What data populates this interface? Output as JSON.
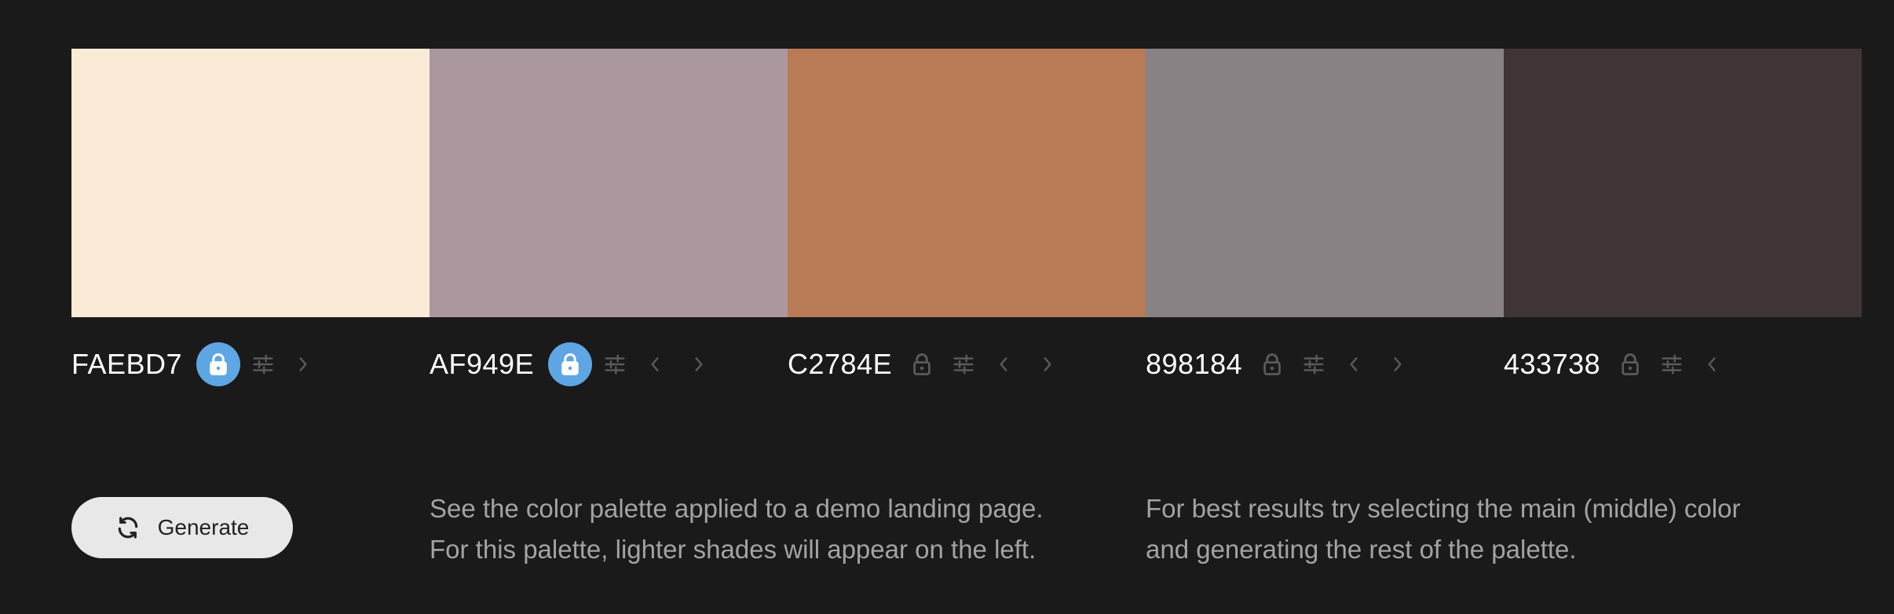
{
  "palette": {
    "colors": [
      {
        "hex": "FAEBD7",
        "value": "#FAEBD7",
        "locked": true,
        "prev": false,
        "next": true
      },
      {
        "hex": "AF949E",
        "value": "#AB979E",
        "locked": true,
        "prev": true,
        "next": true
      },
      {
        "hex": "C2784E",
        "value": "#B87B55",
        "locked": false,
        "prev": true,
        "next": true
      },
      {
        "hex": "898184",
        "value": "#888284",
        "locked": false,
        "prev": true,
        "next": true
      },
      {
        "hex": "433738",
        "value": "#403536",
        "locked": false,
        "prev": true,
        "next": false
      }
    ]
  },
  "icons": {
    "lock": "lock-icon",
    "adjust": "sliders-icon",
    "prev": "chevron-left-icon",
    "next": "chevron-right-icon",
    "refresh": "refresh-icon"
  },
  "colors": {
    "background": "#1a1a1a",
    "lock_active": "#5ea6e4",
    "icon_muted": "#5a5a5a",
    "button_bg": "#e8e8e8"
  },
  "generate": {
    "label": "Generate"
  },
  "info": {
    "left": [
      "See the color palette applied to a demo landing page.",
      "For this palette, lighter shades will appear on the left."
    ],
    "right": [
      "For best results try selecting the main (middle) color",
      "and generating the rest of the palette."
    ]
  }
}
